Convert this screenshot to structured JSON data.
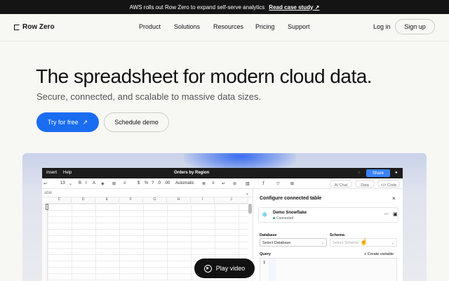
{
  "banner": {
    "text": "AWS rolls out Row Zero to expand self-serve analytics",
    "link": "Read case study",
    "link_icon": "↗"
  },
  "nav": {
    "brand": "Row Zero",
    "links": [
      "Product",
      "Solutions",
      "Resources",
      "Pricing",
      "Support"
    ],
    "login": "Log in",
    "signup": "Sign up"
  },
  "hero": {
    "title": "The spreadsheet for modern cloud data.",
    "subtitle": "Secure, connected, and scalable to massive data sizes.",
    "cta_primary": "Try for free",
    "cta_primary_icon": "↗",
    "cta_secondary": "Schedule demo"
  },
  "app": {
    "menu": [
      "Insert",
      "Help"
    ],
    "doc_title": "Orders by Region",
    "share": "Share",
    "toolbar": {
      "zoom": "13",
      "format": "Automatic",
      "ai_chat": "AI Chat",
      "data": "Data",
      "code": "</> Code",
      "symbols": [
        "$",
        "%",
        "?",
        ".0",
        ".00",
        "B",
        "I"
      ]
    },
    "formula_placeholder": "able",
    "columns": [
      "C",
      "D",
      "E",
      "F",
      "G",
      "H",
      "I",
      "J"
    ],
    "panel": {
      "title": "Configure connected table",
      "connection_name": "Demo Snowflake",
      "connection_status": "Connected",
      "database_label": "Database",
      "database_value": "Select Database",
      "schema_label": "Schema",
      "schema_value": "Select Schema",
      "query_label": "Query",
      "create_variable": "+ Create variable",
      "line_number": "1"
    }
  },
  "video": {
    "label": "Play video"
  },
  "colors": {
    "primary": "#1a6cf0",
    "dark": "#111111",
    "snowflake": "#29b5e8",
    "connected": "#22a55a"
  }
}
